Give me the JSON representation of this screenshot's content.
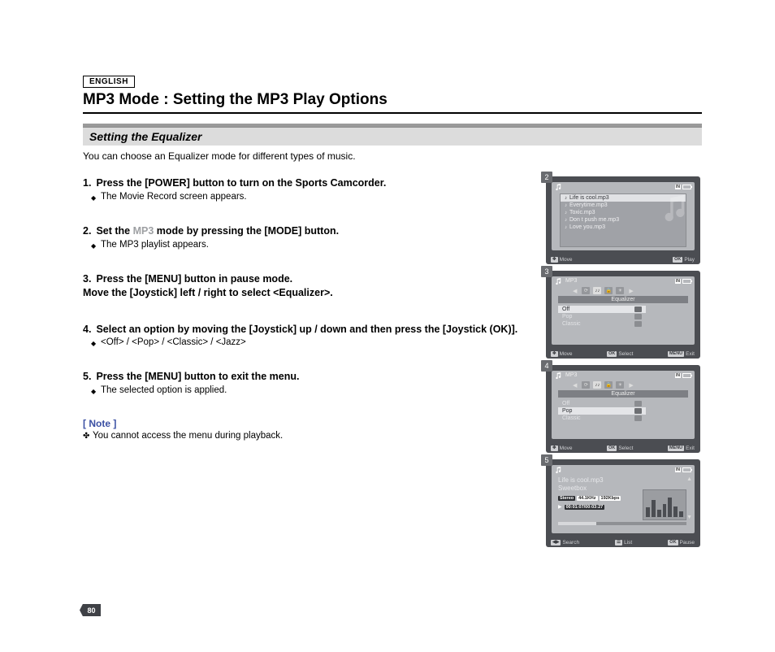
{
  "language_label": "ENGLISH",
  "page_title": "MP3 Mode : Setting the MP3 Play Options",
  "section_subtitle": "Setting the Equalizer",
  "intro_text": "You can choose an Equalizer mode for different types of music.",
  "steps": [
    {
      "head_before": "Press the [POWER] button to turn on the Sports Camcorder.",
      "sub": "The Movie Record screen appears."
    },
    {
      "head_before": "Set the ",
      "head_grey": "MP3",
      "head_after": " mode by pressing the [MODE] button.",
      "sub": "The MP3 playlist appears."
    },
    {
      "head_before": "Press the [MENU] button in pause mode.\nMove the [Joystick] left / right to select <Equalizer>.",
      "sub": ""
    },
    {
      "head_before": "Select an option by moving the [Joystick] up / down and then press the [Joystick (OK)].",
      "sub": "<Off> / <Pop> / <Classic> / <Jazz>"
    },
    {
      "head_before": "Press the [MENU] button to exit the menu.",
      "sub": "The selected option is applied."
    }
  ],
  "note_label": "[ Note ]",
  "note_text": "You cannot access the menu during playback.",
  "page_number": "80",
  "shots": {
    "s2": {
      "num": "2",
      "playlist": [
        "Life is cool.mp3",
        "Everytime.mp3",
        "Toxic.mp3",
        "Don t push me.mp3",
        "Love you.mp3"
      ],
      "foot_left": "Move",
      "foot_left_icon": "✥",
      "foot_right": "Play",
      "foot_right_icon": "OK"
    },
    "s3": {
      "num": "3",
      "mode_label": "MP3",
      "menu_title": "Equalizer",
      "options": [
        "Off",
        "Pop",
        "Classic"
      ],
      "selected_index": 0,
      "foot_left": "Move",
      "foot_left_icon": "✥",
      "foot_mid": "Select",
      "foot_mid_icon": "OK",
      "foot_right": "Exit",
      "foot_right_icon": "MENU"
    },
    "s4": {
      "num": "4",
      "mode_label": "MP3",
      "menu_title": "Equalizer",
      "options": [
        "Off",
        "Pop",
        "Classic"
      ],
      "selected_index": 1,
      "foot_left": "Move",
      "foot_left_icon": "✥",
      "foot_mid": "Select",
      "foot_mid_icon": "OK",
      "foot_right": "Exit",
      "foot_right_icon": "MENU"
    },
    "s5": {
      "num": "5",
      "track": "Life is cool.mp3",
      "artist": "Sweetbox",
      "badges": [
        "Stereo",
        "44.1KHz",
        "192Kbps"
      ],
      "time": "00:01:07/00:03:27",
      "foot_left": "Search",
      "foot_left_icon": "◀▶",
      "foot_mid": "List",
      "foot_mid_icon": "☰",
      "foot_right": "Pause",
      "foot_right_icon": "OK"
    }
  }
}
